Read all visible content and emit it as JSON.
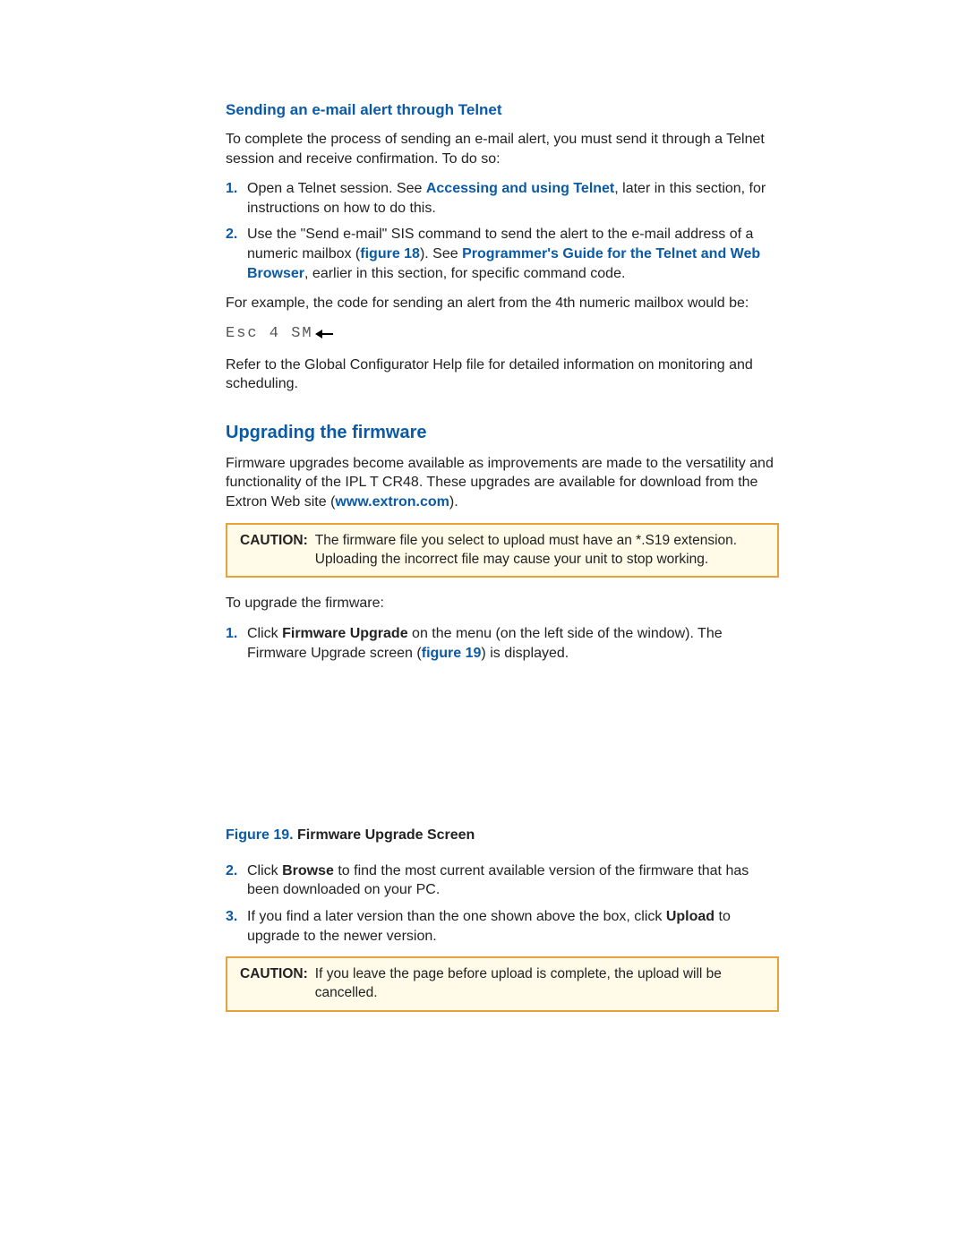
{
  "s1": {
    "heading": "Sending an e-mail alert through Telnet",
    "intro": "To complete the process of sending an e-mail alert, you must send it through a Telnet session and receive confirmation. To do so:",
    "step1_num": "1.",
    "step1_a": "Open a Telnet session. See ",
    "step1_link": "Accessing and using Telnet",
    "step1_b": ", later in this section, for instructions on how to do this.",
    "step2_num": "2.",
    "step2_a": "Use the \"Send e-mail\" SIS command to send the alert to the e-mail address of a numeric mailbox (",
    "step2_fig": "figure 18",
    "step2_b": "). See ",
    "step2_link": "Programmer's Guide for the Telnet and Web Browser",
    "step2_c": ", earlier in this section, for specific command code.",
    "example": "For example, the code for sending an alert from the 4th numeric mailbox would be:",
    "code": "Esc 4 SM",
    "refer_a": "Refer to the ",
    "refer_b": "Global Configurator Help",
    "refer_c": " file for detailed information on monitoring and scheduling."
  },
  "s2": {
    "heading": "Upgrading the firmware",
    "intro_a": "Firmware upgrades become available as improvements are made to the versatility and functionality of the IPL T CR48. These upgrades are available for download from the Extron Web site (",
    "intro_link": "www.extron.com",
    "intro_b": ").",
    "caution1_label": "CAUTION:",
    "caution1_text": "The firmware file you select to upload must have an *.S19 extension. Uploading the incorrect file may cause your unit to stop working.",
    "to_upgrade": "To upgrade the firmware:",
    "step1_num": "1.",
    "step1_a": "Click ",
    "step1_bold": "Firmware Upgrade",
    "step1_b": " on the menu (on the left side of the window). The Firmware Upgrade screen (",
    "step1_fig": "figure 19",
    "step1_c": ") is displayed.",
    "fig_num": "Figure 19.",
    "fig_title": " Firmware Upgrade Screen",
    "step2_num": "2.",
    "step2_a": "Click ",
    "step2_bold": "Browse",
    "step2_b": " to find the most current available version of the firmware that has been downloaded on your PC.",
    "step3_num": "3.",
    "step3_a": "If you find a later version than the one shown above the box, click ",
    "step3_bold": "Upload",
    "step3_b": " to upgrade to the newer version.",
    "caution2_label": "CAUTION:",
    "caution2_text": "If you leave the page before upload is complete, the upload will be cancelled."
  }
}
